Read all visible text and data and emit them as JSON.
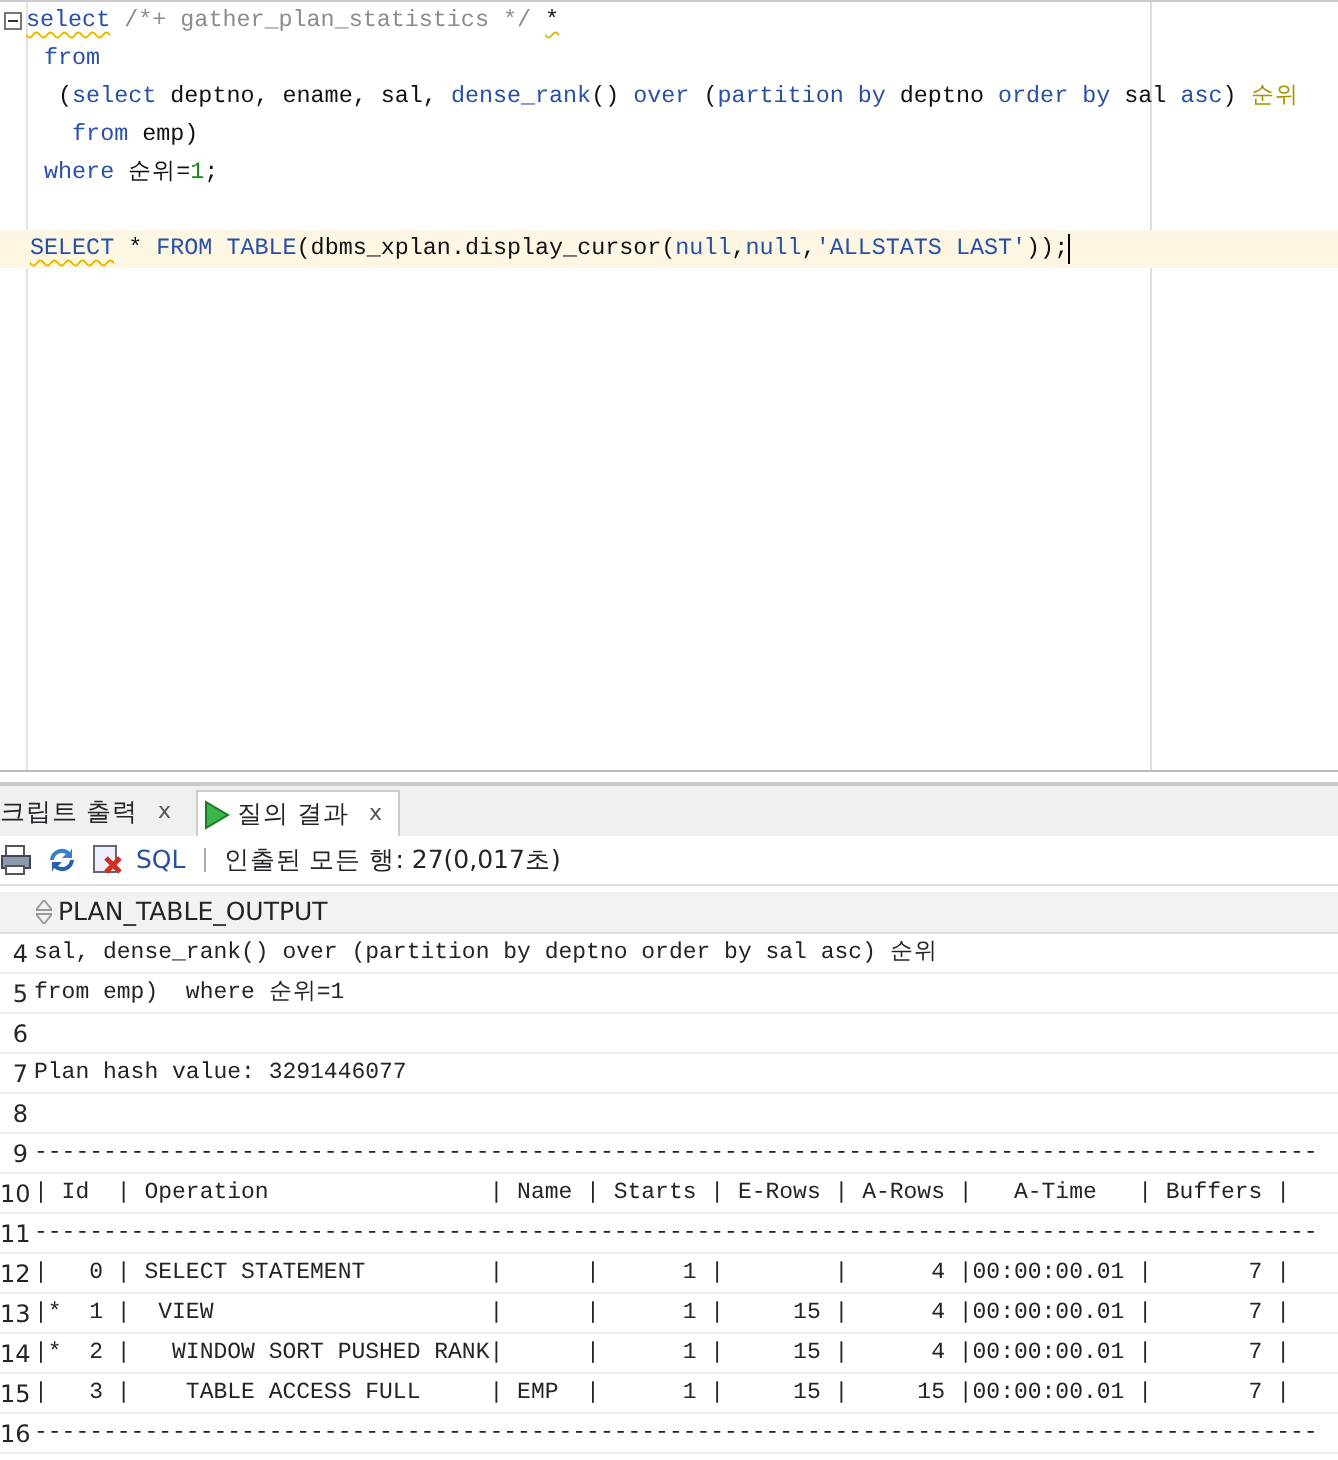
{
  "editor": {
    "lines": [
      {
        "current": false,
        "fold": true,
        "tokens": [
          {
            "text": "select",
            "kind": "keyword",
            "flagged": true
          },
          {
            "text": " /*+ gather_plan_statistics */",
            "kind": "comment",
            "flagged": false
          },
          {
            "text": " *",
            "kind": "plain",
            "flagged": true
          }
        ]
      },
      {
        "current": false,
        "fold": false,
        "tokens": [
          {
            "text": " from",
            "kind": "keyword",
            "flagged": false
          }
        ]
      },
      {
        "current": false,
        "fold": false,
        "tokens": [
          {
            "text": "  (",
            "kind": "plain",
            "flagged": false
          },
          {
            "text": "select",
            "kind": "keyword",
            "flagged": false
          },
          {
            "text": " deptno, ename, sal, ",
            "kind": "plain",
            "flagged": false
          },
          {
            "text": "dense_rank",
            "kind": "keyword",
            "flagged": false
          },
          {
            "text": "() ",
            "kind": "plain",
            "flagged": false
          },
          {
            "text": "over",
            "kind": "keyword",
            "flagged": false
          },
          {
            "text": " (",
            "kind": "plain",
            "flagged": false
          },
          {
            "text": "partition by",
            "kind": "keyword",
            "flagged": false
          },
          {
            "text": " deptno ",
            "kind": "plain",
            "flagged": false
          },
          {
            "text": "order by",
            "kind": "keyword",
            "flagged": false
          },
          {
            "text": " sal ",
            "kind": "plain",
            "flagged": false
          },
          {
            "text": "asc",
            "kind": "keyword",
            "flagged": false
          },
          {
            "text": ") ",
            "kind": "plain",
            "flagged": false
          },
          {
            "text": "순위",
            "kind": "alias",
            "flagged": false
          }
        ]
      },
      {
        "current": false,
        "fold": false,
        "tokens": [
          {
            "text": "   from",
            "kind": "keyword",
            "flagged": false
          },
          {
            "text": " emp)",
            "kind": "plain",
            "flagged": false
          }
        ]
      },
      {
        "current": false,
        "fold": false,
        "tokens": [
          {
            "text": " where",
            "kind": "keyword",
            "flagged": false
          },
          {
            "text": " 순위=",
            "kind": "plain",
            "flagged": false
          },
          {
            "text": "1",
            "kind": "number",
            "flagged": false
          },
          {
            "text": ";",
            "kind": "plain",
            "flagged": false
          }
        ]
      },
      {
        "current": false,
        "fold": false
      },
      {
        "current": true,
        "fold": false,
        "tokens": [
          {
            "text": "SELECT",
            "kind": "keyword",
            "flagged": true
          },
          {
            "text": " * ",
            "kind": "plain",
            "flagged": false
          },
          {
            "text": "FROM",
            "kind": "keyword",
            "flagged": false
          },
          {
            "text": " TABLE",
            "kind": "keyword",
            "flagged": false
          },
          {
            "text": "(dbms_xplan.display_cursor(",
            "kind": "plain",
            "flagged": false
          },
          {
            "text": "null",
            "kind": "keyword",
            "flagged": false
          },
          {
            "text": ",",
            "kind": "plain",
            "flagged": false
          },
          {
            "text": "null",
            "kind": "keyword",
            "flagged": false
          },
          {
            "text": ",",
            "kind": "plain",
            "flagged": false
          },
          {
            "text": "'ALLSTATS LAST'",
            "kind": "string",
            "flagged": false
          },
          {
            "text": "));",
            "kind": "plain",
            "flagged": false
          }
        ]
      }
    ]
  },
  "tabs": [
    {
      "label": "크립트 출력",
      "selected": false,
      "close": "x",
      "kind": "text"
    },
    {
      "label": "질의 결과",
      "selected": true,
      "close": "x",
      "kind": "run"
    }
  ],
  "toolbar": {
    "sql_link": "SQL",
    "status": "인출된 모든 행: 27(0,017초)"
  },
  "grid": {
    "column": "PLAN_TABLE_OUTPUT",
    "rows": [
      {
        "number": "4",
        "text": "sal, dense_rank() over (partition by deptno order by sal asc) 순위"
      },
      {
        "number": "5",
        "text": "from emp)  where 순위=1"
      },
      {
        "number": "6"
      },
      {
        "number": "7",
        "text": "Plan hash value: 3291446077"
      },
      {
        "number": "8"
      },
      {
        "number": "9",
        "text": "---------------------------------------------------------------------------------------------"
      },
      {
        "number": "10",
        "text": "| Id  | Operation                | Name | Starts | E-Rows | A-Rows |   A-Time   | Buffers |"
      },
      {
        "number": "11",
        "text": "---------------------------------------------------------------------------------------------"
      },
      {
        "number": "12",
        "text": "|   0 | SELECT STATEMENT         |      |      1 |        |      4 |00:00:00.01 |       7 |"
      },
      {
        "number": "13",
        "text": "|*  1 |  VIEW                    |      |      1 |     15 |      4 |00:00:00.01 |       7 |"
      },
      {
        "number": "14",
        "text": "|*  2 |   WINDOW SORT PUSHED RANK|      |      1 |     15 |      4 |00:00:00.01 |       7 |"
      },
      {
        "number": "15",
        "text": "|   3 |    TABLE ACCESS FULL     | EMP  |      1 |     15 |     15 |00:00:00.01 |       7 |"
      },
      {
        "number": "16",
        "text": "---------------------------------------------------------------------------------------------"
      }
    ]
  }
}
